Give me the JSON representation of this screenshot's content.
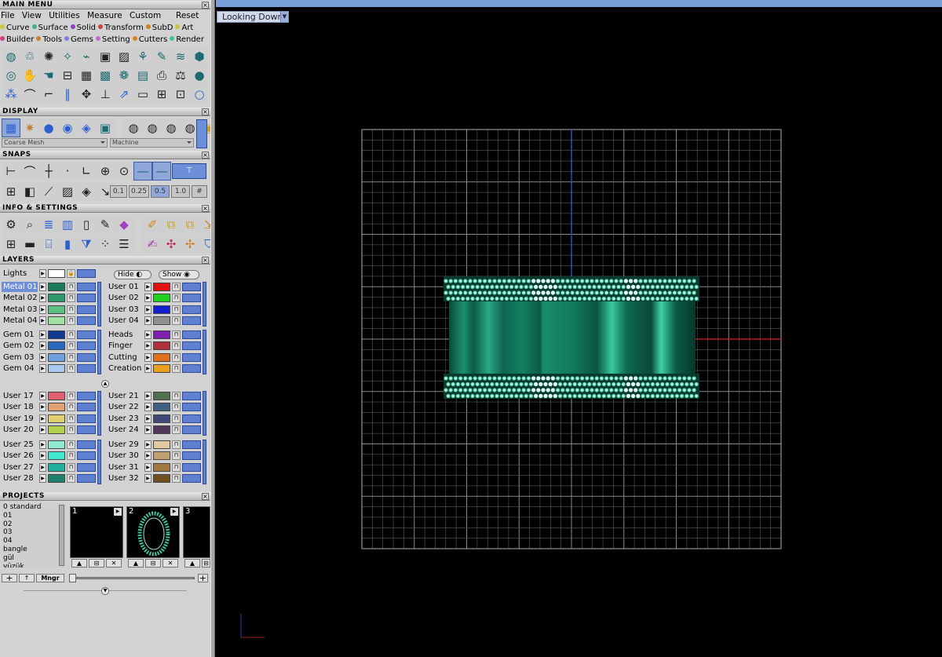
{
  "main_menu": {
    "title": "MAIN MENU",
    "menus": [
      "File",
      "View",
      "Utilities",
      "Measure",
      "Custom"
    ],
    "reset_label": "Reset",
    "categories_row1": [
      {
        "label": "Curve",
        "color": "#c8c840"
      },
      {
        "label": "Surface",
        "color": "#40b080"
      },
      {
        "label": "Solid",
        "color": "#9040c0"
      },
      {
        "label": "Transform",
        "color": "#d04040"
      },
      {
        "label": "SubD",
        "color": "#d08020"
      },
      {
        "label": "Art",
        "color": "#d0c040"
      }
    ],
    "categories_row2": [
      {
        "label": "Builder",
        "color": "#d04080"
      },
      {
        "label": "Tools",
        "color": "#d08030"
      },
      {
        "label": "Gems",
        "color": "#8080e0"
      },
      {
        "label": "Setting",
        "color": "#c070c0"
      },
      {
        "label": "Cutters",
        "color": "#e08020"
      },
      {
        "label": "Render",
        "color": "#40c0a0"
      }
    ]
  },
  "display": {
    "title": "DISPLAY",
    "mesh_mode": "Coarse Mesh",
    "render_mode": "Machine"
  },
  "snaps": {
    "title": "SNAPS",
    "step_values": [
      "0.1",
      "0.25",
      "0.5",
      "1.0"
    ]
  },
  "info_settings": {
    "title": "INFO & SETTINGS"
  },
  "layers": {
    "title": "LAYERS",
    "lights_label": "Lights",
    "hide_label": "Hide",
    "show_label": "Show",
    "groups": [
      {
        "left": [
          {
            "name": "Metal 01",
            "color": "#1a7a5a",
            "selected": true
          },
          {
            "name": "Metal 02",
            "color": "#2c9a6c"
          },
          {
            "name": "Metal 03",
            "color": "#5cc080"
          },
          {
            "name": "Metal 04",
            "color": "#a0e0a0"
          }
        ],
        "right": [
          {
            "name": "User 01",
            "color": "#e01010"
          },
          {
            "name": "User 02",
            "color": "#20d020"
          },
          {
            "name": "User 03",
            "color": "#1020d0"
          },
          {
            "name": "User 04",
            "color": "#909090"
          }
        ]
      },
      {
        "left": [
          {
            "name": "Gem 01",
            "color": "#103890"
          },
          {
            "name": "Gem 02",
            "color": "#2a68c0"
          },
          {
            "name": "Gem 03",
            "color": "#70a0e0"
          },
          {
            "name": "Gem 04",
            "color": "#a8c8f0"
          }
        ],
        "right": [
          {
            "name": "Heads",
            "color": "#8020b0"
          },
          {
            "name": "Finger",
            "color": "#b03040"
          },
          {
            "name": "Cutting",
            "color": "#e07020"
          },
          {
            "name": "Creation",
            "color": "#e8a020"
          }
        ]
      },
      {
        "left": [
          {
            "name": "User 17",
            "color": "#e06070"
          },
          {
            "name": "User 18",
            "color": "#e0a070"
          },
          {
            "name": "User 19",
            "color": "#e0d070"
          },
          {
            "name": "User 20",
            "color": "#b0d050"
          }
        ],
        "right": [
          {
            "name": "User 21",
            "color": "#507050"
          },
          {
            "name": "User 22",
            "color": "#406080"
          },
          {
            "name": "User 23",
            "color": "#404878"
          },
          {
            "name": "User 24",
            "color": "#503858"
          }
        ]
      },
      {
        "left": [
          {
            "name": "User 25",
            "color": "#90e8d0"
          },
          {
            "name": "User 26",
            "color": "#40e8d0"
          },
          {
            "name": "User 27",
            "color": "#20b0a0"
          },
          {
            "name": "User 28",
            "color": "#208070"
          }
        ],
        "right": [
          {
            "name": "User 29",
            "color": "#e0c8a0"
          },
          {
            "name": "User 30",
            "color": "#c0a070"
          },
          {
            "name": "User 31",
            "color": "#a07840"
          },
          {
            "name": "User 32",
            "color": "#705020"
          }
        ]
      }
    ]
  },
  "projects": {
    "title": "PROJECTS",
    "items": [
      "0 standard",
      "01",
      "02",
      "03",
      "04",
      "bangle",
      "gül",
      "yüzük"
    ],
    "slots": [
      "1",
      "2",
      "3"
    ],
    "manager_label": "Mngr"
  },
  "viewport": {
    "view_name": "Looking Down",
    "grid_color": "#5a5a5a",
    "gem_color": "#30b088",
    "metal_color": "#128060"
  }
}
